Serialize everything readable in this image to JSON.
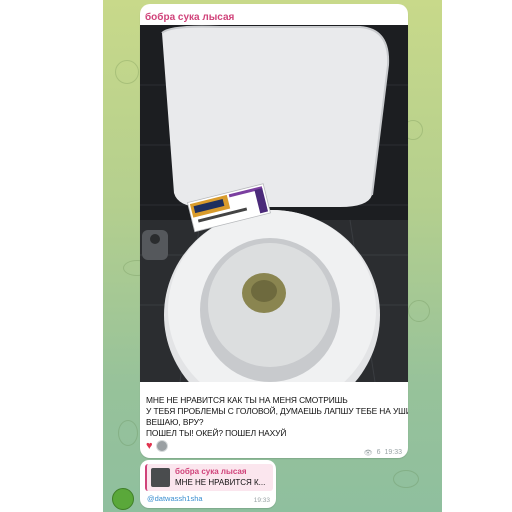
{
  "message": {
    "sender": "бобра сука лысая",
    "caption_lines": [
      "МНЕ НЕ НРАВИТСЯ КАК ТЫ НА МЕНЯ СМОТРИШЬ",
      "У ТЕБЯ ПРОБЛЕМЫ С ГОЛОВОЙ, ДУМАЕШЬ ЛАПШУ ТЕБЕ НА УШИ",
      "ВЕШАЮ, ВРУ?",
      "ПОШЕЛ ТЫ! ОКЕЙ? ПОШЕЛ НАХУЙ"
    ],
    "reaction_emoji": "♥",
    "views": "6",
    "time": "19:33"
  },
  "reply": {
    "quoted_name": "бобра сука лысая",
    "quoted_text": "МНЕ НЕ НРАВИТСЯ К...",
    "username": "@datwassh1sha",
    "time": "19:33"
  },
  "colors": {
    "sender_pink": "#d0437a",
    "username_blue": "#3a8fd0",
    "chat_green": "#b4cf8e"
  }
}
